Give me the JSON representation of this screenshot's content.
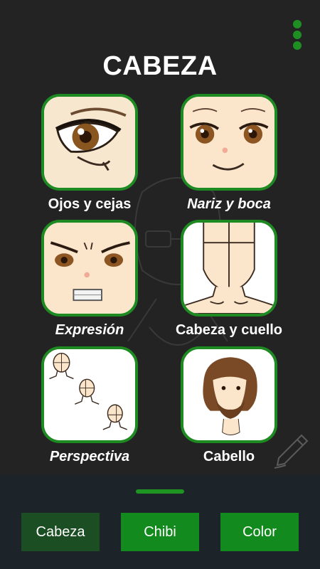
{
  "header": {
    "title": "CABEZA"
  },
  "menu": {
    "icon": "vertical-dots-icon"
  },
  "tiles": [
    {
      "label": "Ojos y cejas",
      "icon": "eye-thumbnail"
    },
    {
      "label": "Nariz y boca",
      "icon": "nose-mouth-thumbnail"
    },
    {
      "label": "Expresión",
      "icon": "expression-thumbnail"
    },
    {
      "label": "Cabeza y cuello",
      "icon": "head-neck-thumbnail"
    },
    {
      "label": "Perspectiva",
      "icon": "perspective-thumbnail"
    },
    {
      "label": "Cabello",
      "icon": "hair-thumbnail"
    }
  ],
  "bottom": {
    "tabs": [
      {
        "label": "Cabeza",
        "active": true
      },
      {
        "label": "Chibi",
        "active": false
      },
      {
        "label": "Color",
        "active": false
      }
    ]
  },
  "colors": {
    "accent": "#1e8a22",
    "background": "#232323",
    "bar": "#1c2329",
    "active_tab": "#1b4e22"
  }
}
